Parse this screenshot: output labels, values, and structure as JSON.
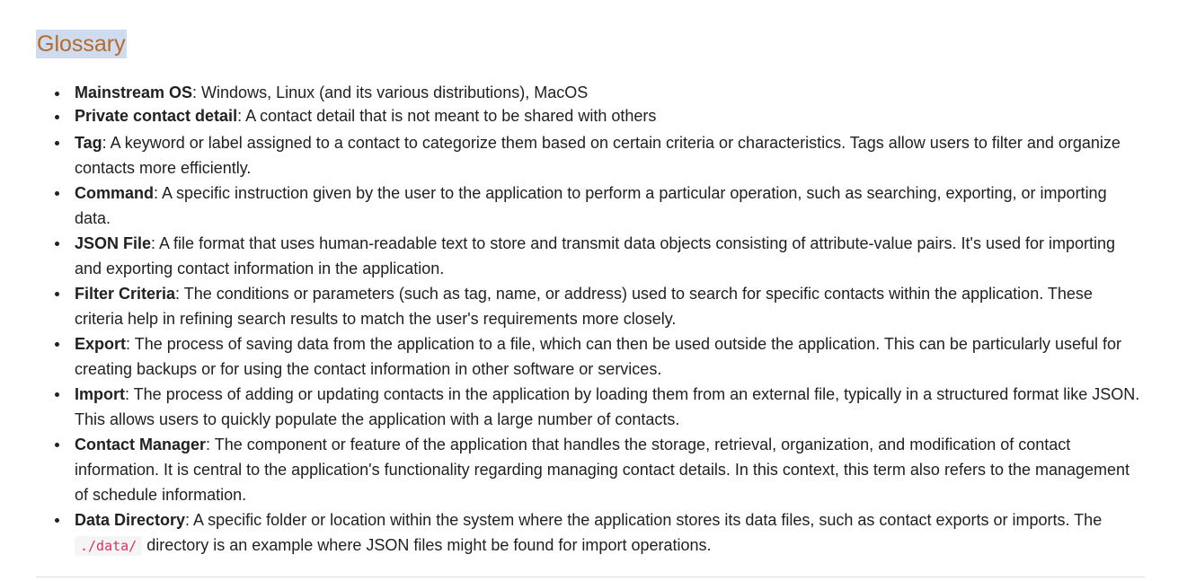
{
  "heading": "Glossary",
  "entries": [
    {
      "term": "Mainstream OS",
      "definition": ": Windows, Linux (and its various distributions), MacOS"
    },
    {
      "term": "Private contact detail",
      "definition": ": A contact detail that is not meant to be shared with others"
    },
    {
      "term": "Tag",
      "definition": ": A keyword or label assigned to a contact to categorize them based on certain criteria or characteristics. Tags allow users to filter and organize contacts more efficiently."
    },
    {
      "term": "Command",
      "definition": ": A specific instruction given by the user to the application to perform a particular operation, such as searching, exporting, or importing data."
    },
    {
      "term": "JSON File",
      "definition": ": A file format that uses human-readable text to store and transmit data objects consisting of attribute-value pairs. It's used for importing and exporting contact information in the application."
    },
    {
      "term": "Filter Criteria",
      "definition": ": The conditions or parameters (such as tag, name, or address) used to search for specific contacts within the application. These criteria help in refining search results to match the user's requirements more closely."
    },
    {
      "term": "Export",
      "definition": ": The process of saving data from the application to a file, which can then be used outside the application. This can be particularly useful for creating backups or for using the contact information in other software or services."
    },
    {
      "term": "Import",
      "definition": ": The process of adding or updating contacts in the application by loading them from an external file, typically in a structured format like JSON. This allows users to quickly populate the application with a large number of contacts."
    },
    {
      "term": "Contact Manager",
      "definition": ": The component or feature of the application that handles the storage, retrieval, organization, and modification of contact information. It is central to the application's functionality regarding managing contact details. In this context, this term also refers to the management of schedule information."
    },
    {
      "term": "Data Directory",
      "definition_before": ": A specific folder or location within the system where the application stores its data files, such as contact exports or imports. The ",
      "code": "./data/",
      "definition_after": " directory is an example where JSON files might be found for import operations."
    }
  ],
  "colors": {
    "heading": "#b8692a",
    "heading_highlight": "#cfdcf0",
    "code": "#d6336c"
  }
}
